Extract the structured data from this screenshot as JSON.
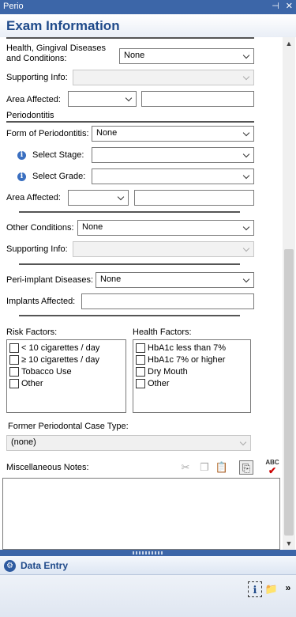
{
  "window": {
    "title": "Perio",
    "pin_glyph": "⊣",
    "close_glyph": "✕"
  },
  "header": {
    "title": "Exam Information"
  },
  "health_gingival": {
    "label": "Health, Gingival Diseases\nand Conditions:",
    "label_line1": "Health, Gingival Diseases",
    "label_line2": "and Conditions:",
    "value": "None"
  },
  "supporting_info_1": {
    "label": "Supporting Info:",
    "value": ""
  },
  "area_affected_1": {
    "label": "Area Affected:",
    "select_value": "",
    "text_value": ""
  },
  "periodontitis": {
    "section_label": "Periodontitis"
  },
  "form_of_periodontitis": {
    "label": "Form of Periodontitis:",
    "value": "None"
  },
  "select_stage": {
    "label": "Select Stage:",
    "value": ""
  },
  "select_grade": {
    "label": "Select Grade:",
    "value": ""
  },
  "area_affected_2": {
    "label": "Area Affected:",
    "select_value": "",
    "text_value": ""
  },
  "other_conditions": {
    "label": "Other Conditions:",
    "value": "None"
  },
  "supporting_info_2": {
    "label": "Supporting Info:",
    "value": ""
  },
  "peri_implant": {
    "label": "Peri-implant Diseases:",
    "value": "None"
  },
  "implants_affected": {
    "label": "Implants Affected:",
    "value": ""
  },
  "risk_factors": {
    "label": "Risk Factors:",
    "items": [
      {
        "label": "< 10 cigarettes / day",
        "checked": false
      },
      {
        "label": "≥ 10 cigarettes / day",
        "checked": false
      },
      {
        "label": "Tobacco Use",
        "checked": false
      },
      {
        "label": "Other",
        "checked": false
      }
    ]
  },
  "health_factors": {
    "label": "Health Factors:",
    "items": [
      {
        "label": "HbA1c less than 7%",
        "checked": false
      },
      {
        "label": "HbA1c 7% or higher",
        "checked": false
      },
      {
        "label": "Dry Mouth",
        "checked": false
      },
      {
        "label": "Other",
        "checked": false
      }
    ]
  },
  "former_case_type": {
    "label": "Former Periodontal Case Type:",
    "value": "(none)"
  },
  "misc_notes": {
    "label": "Miscellaneous Notes:",
    "value": ""
  },
  "icons": {
    "info": "i",
    "cut": "✂",
    "copy": "❐",
    "paste": "📋",
    "insert": "⎘",
    "spell": "ABC",
    "spell_check": "✔",
    "data_entry": "⚙",
    "help": "ℹ",
    "folder": "📁",
    "more": "»"
  },
  "footer": {
    "data_entry_label": "Data Entry"
  },
  "colors": {
    "titlebar": "#3c66a8",
    "header_text": "#1f4a8a"
  }
}
